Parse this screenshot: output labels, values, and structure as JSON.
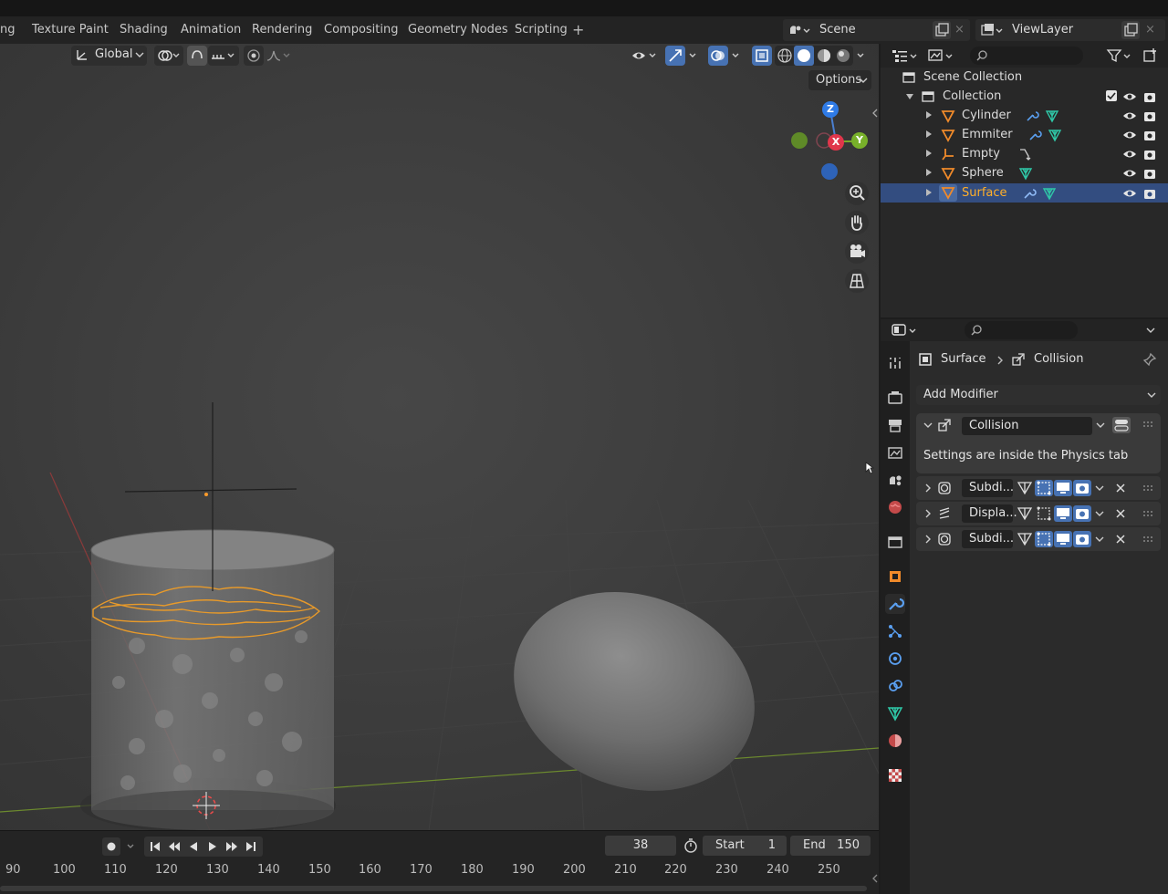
{
  "workspace_tabs": [
    "ng",
    "Texture Paint",
    "Shading",
    "Animation",
    "Rendering",
    "Compositing",
    "Geometry Nodes",
    "Scripting"
  ],
  "add_workspace_label": "+",
  "scene": {
    "label": "Scene",
    "close": "×"
  },
  "view_layer": {
    "label": "ViewLayer",
    "close": "×"
  },
  "viewport": {
    "orientation": "Global",
    "options_label": "Options",
    "gizmo": {
      "z": "Z",
      "x": "X",
      "y": "Y"
    }
  },
  "timeline": {
    "current_frame": "38",
    "start_label": "Start",
    "start_value": "1",
    "end_label": "End",
    "end_value": "150",
    "ticks": [
      "90",
      "100",
      "110",
      "120",
      "130",
      "140",
      "150",
      "160",
      "170",
      "180",
      "190",
      "200",
      "210",
      "220",
      "230",
      "240",
      "250"
    ]
  },
  "outliner": {
    "scene_collection": "Scene Collection",
    "collection": "Collection",
    "objects": [
      {
        "name": "Cylinder",
        "icon": "mesh-icon"
      },
      {
        "name": "Emmiter",
        "icon": "mesh-icon"
      },
      {
        "name": "Empty",
        "icon": "empty-icon"
      },
      {
        "name": "Sphere",
        "icon": "mesh-icon"
      },
      {
        "name": "Surface",
        "icon": "mesh-icon",
        "selected": true
      }
    ]
  },
  "properties": {
    "breadcrumb_object": "Surface",
    "breadcrumb_modifier": "Collision",
    "add_modifier_label": "Add Modifier",
    "collision": {
      "name": "Collision",
      "info": "Settings are inside the Physics tab"
    },
    "modifiers": [
      {
        "name": "Subdi..."
      },
      {
        "name": "Displa..."
      },
      {
        "name": "Subdi..."
      }
    ]
  },
  "colors": {
    "accent": "#4772b3",
    "selection_orange": "#ffaf29",
    "panel_bg": "#2b2b2b"
  }
}
